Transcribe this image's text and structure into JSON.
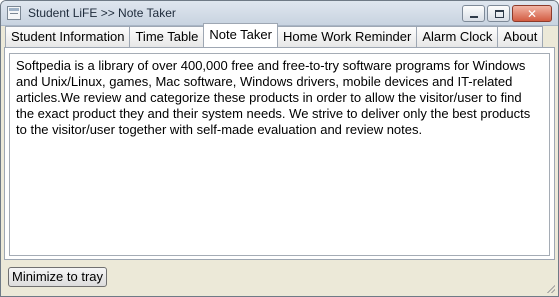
{
  "window": {
    "title": "Student LiFE >> Note Taker",
    "icon": "notebook-icon"
  },
  "tabs": [
    {
      "label": "Student Information",
      "active": false
    },
    {
      "label": "Time Table",
      "active": false
    },
    {
      "label": "Note Taker",
      "active": true
    },
    {
      "label": "Home Work Reminder",
      "active": false
    },
    {
      "label": "Alarm Clock",
      "active": false
    },
    {
      "label": "About",
      "active": false
    }
  ],
  "note": {
    "text": "Softpedia is a library of over 400,000 free and free-to-try software programs for Windows and Unix/Linux, games, Mac software, Windows drivers, mobile devices and IT-related articles.We review and categorize these products in order to allow the visitor/user to find the exact product they and their system needs. We strive to deliver only the best products to the visitor/user together with self-made evaluation and review notes."
  },
  "footer": {
    "minimize_label": "Minimize to tray"
  }
}
